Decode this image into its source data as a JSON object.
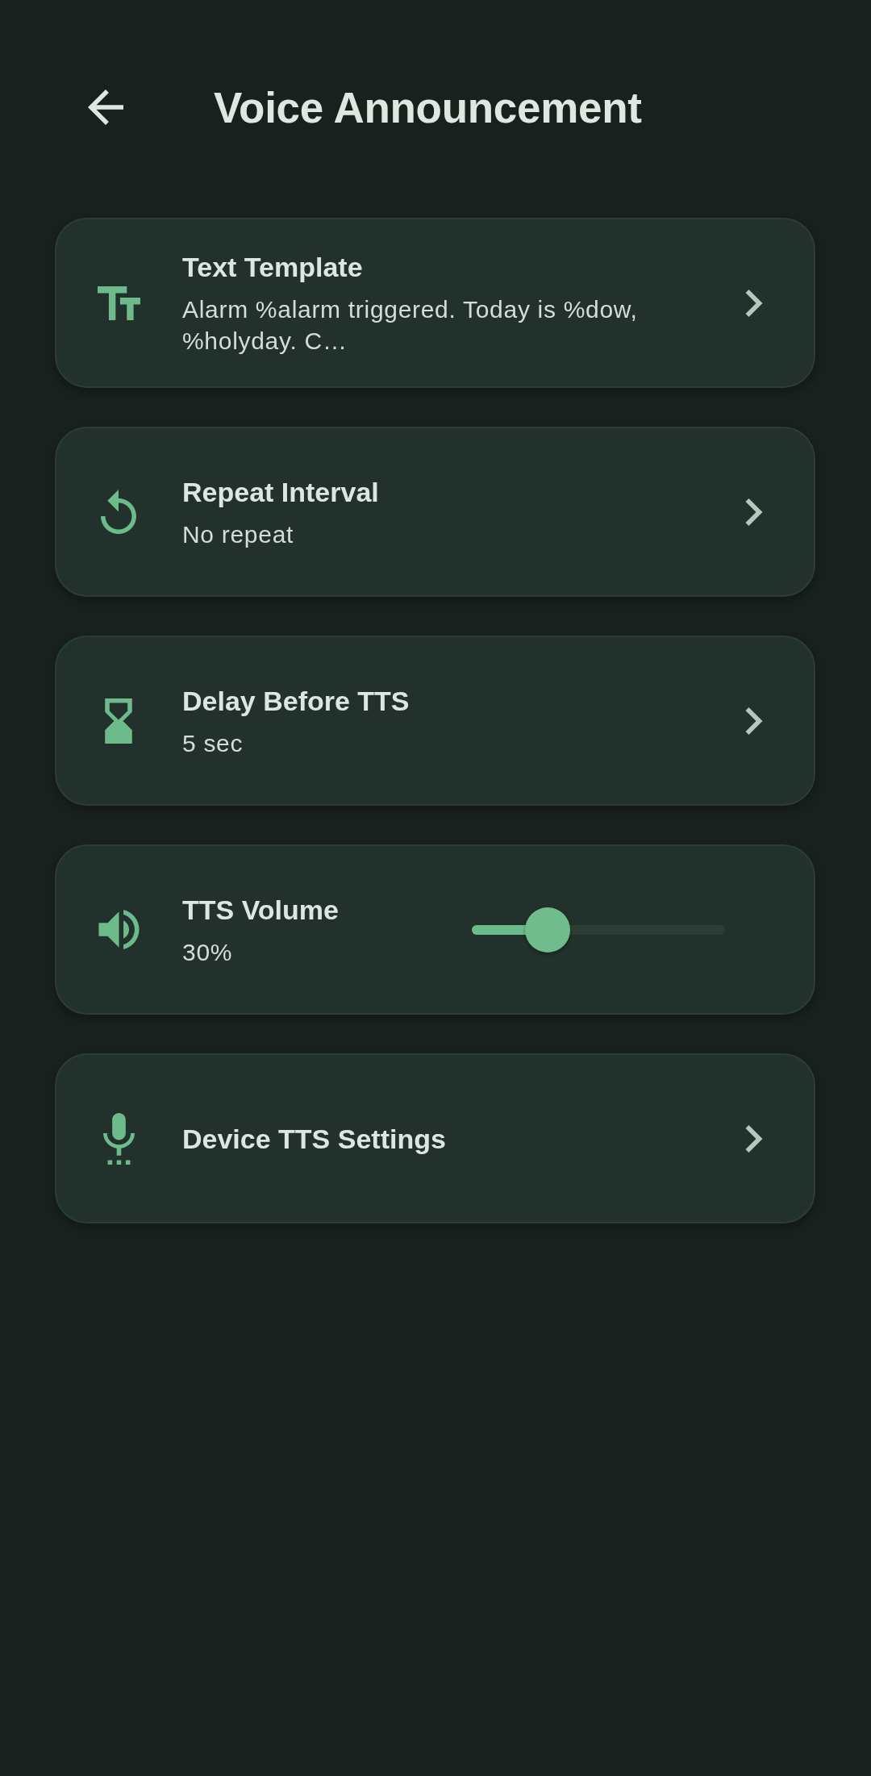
{
  "header": {
    "title": "Voice Announcement"
  },
  "settings": [
    {
      "kind": "link",
      "title": "Text Template",
      "value": "Alarm %alarm triggered. Today is %dow, %holyday. C…"
    },
    {
      "kind": "link",
      "title": "Repeat Interval",
      "value": "No repeat"
    },
    {
      "kind": "link",
      "title": "Delay Before TTS",
      "value": "5 sec"
    },
    {
      "kind": "slider",
      "title": "TTS Volume",
      "value": "30%",
      "level": 0.3
    },
    {
      "kind": "link",
      "title": "Device TTS Settings"
    }
  ]
}
